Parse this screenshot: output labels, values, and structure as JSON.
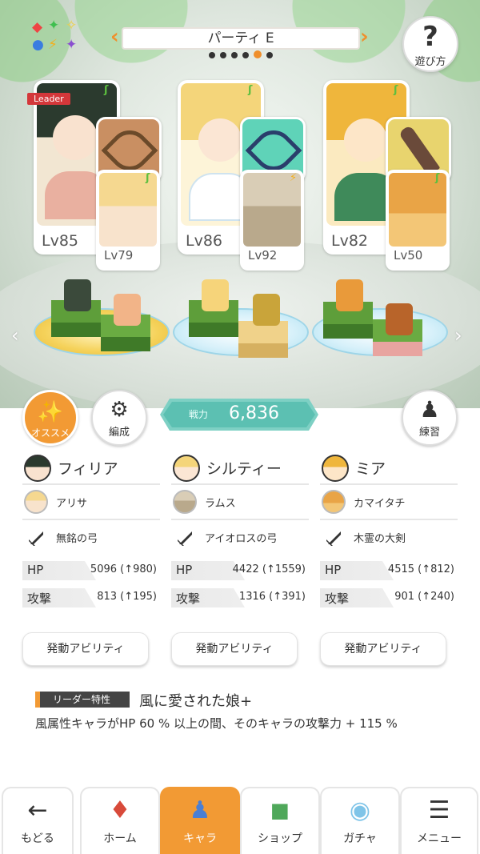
{
  "header": {
    "party_name": "パーティ E",
    "page_count": 6,
    "active_page": 5,
    "help_label": "遊び方"
  },
  "party": [
    {
      "leader_tag": "Leader",
      "main_level": "Lv85",
      "sub_level": "Lv79",
      "portrait_color": "#f2e6d2",
      "hair_color": "#2b3a2e",
      "weapon_bg": "#c98f62",
      "sub_color": "#f5d890"
    },
    {
      "main_level": "Lv86",
      "sub_level": "Lv92",
      "portrait_color": "#fdf4d8",
      "hair_color": "#f4d57a",
      "weapon_bg": "#5fd3b8",
      "sub_color": "#b9a98c"
    },
    {
      "main_level": "Lv82",
      "sub_level": "Lv50",
      "portrait_color": "#fbeac0",
      "hair_color": "#efb63c",
      "weapon_bg": "#e8d46e",
      "sub_color": "#e9a446"
    }
  ],
  "controls": {
    "recommend_label": "オススメ",
    "formation_label": "編成",
    "power_label": "戦力",
    "power_value": "6,836",
    "practice_label": "練習"
  },
  "members": [
    {
      "name": "フィリア",
      "sub_name": "アリサ",
      "weapon": "無銘の弓",
      "hp_label": "HP",
      "hp_value": "5096 (↑980)",
      "atk_label": "攻撃",
      "atk_value": "813 (↑195)",
      "ability_label": "発動アビリティ"
    },
    {
      "name": "シルティー",
      "sub_name": "ラムス",
      "weapon": "アイオロスの弓",
      "hp_label": "HP",
      "hp_value": "4422 (↑1559)",
      "atk_label": "攻撃",
      "atk_value": "1316 (↑391)",
      "ability_label": "発動アビリティ"
    },
    {
      "name": "ミア",
      "sub_name": "カマイタチ",
      "weapon": "木霊の大剣",
      "hp_label": "HP",
      "hp_value": "4515 (↑812)",
      "atk_label": "攻撃",
      "atk_value": "901 (↑240)",
      "ability_label": "発動アビリティ"
    }
  ],
  "leader_skill": {
    "tag": "リーダー特性",
    "title": "風に愛された娘+",
    "description": "風属性キャラがHP 60 % 以上の間、そのキャラの攻撃力 + 115 %"
  },
  "nav": {
    "back": "もどる",
    "home": "ホーム",
    "chara": "キャラ",
    "shop": "ショップ",
    "gacha": "ガチャ",
    "menu": "メニュー"
  },
  "colors": {
    "accent": "#f29a34",
    "power": "#5cc0b2",
    "wind": "#5cbf3f"
  }
}
